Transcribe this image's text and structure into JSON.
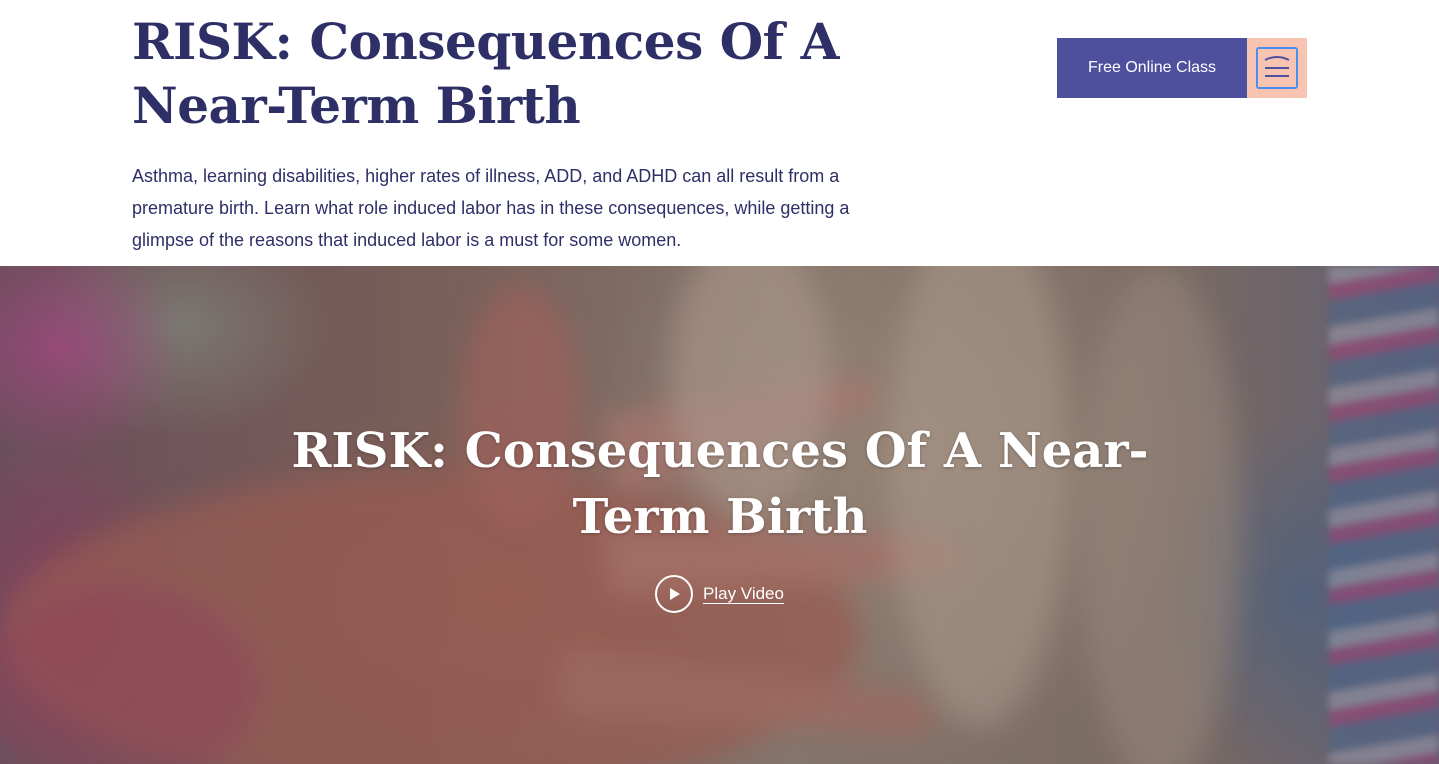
{
  "header": {
    "title": "RISK: Consequences Of A Near-Term Birth",
    "intro": "Asthma, learning disabilities, higher rates of illness, ADD, and ADHD can all result from a premature birth. Learn what role induced labor has in these consequences, while getting a glimpse of the reasons that induced labor is a must for some women."
  },
  "nav": {
    "cta_label": "Free Online Class",
    "menu_icon": "menu-icon"
  },
  "hero": {
    "title": "RISK: Consequences Of A Near-Term Birth",
    "play_label": "Play Video",
    "play_icon": "play-icon"
  },
  "colors": {
    "title_text": "#2e2f66",
    "cta_bg": "#4e4f9d",
    "menu_bg": "#f6c4b0",
    "menu_border": "#4a8ff0"
  }
}
